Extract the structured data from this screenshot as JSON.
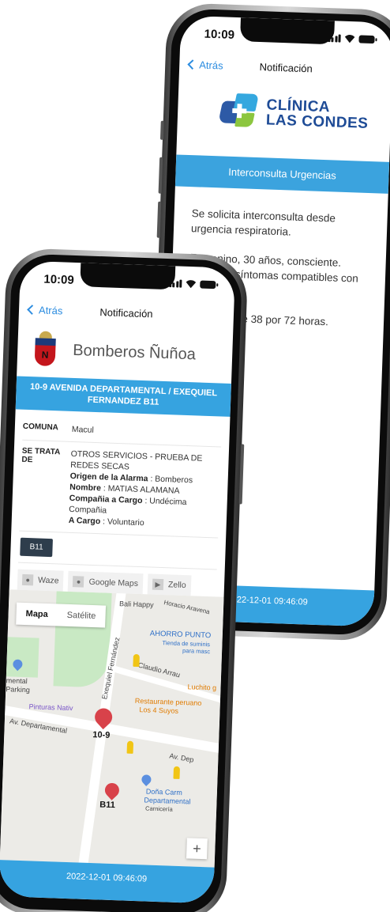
{
  "back_phone": {
    "status_time": "10:09",
    "back_label": "Atrás",
    "nav_title": "Notificación",
    "logo_line1": "CLÍNICA",
    "logo_line2": "LAS CONDES",
    "banner": "Interconsulta Urgencias",
    "body": [
      "Se solicita interconsulta desde urgencia respiratoria.",
      "Femenino, 30 años, consciente. Presenta síntomas compatibles con FQ.",
      "Fiebre sobre 38 por 72 horas."
    ],
    "footer": "2022-12-01 09:46:09"
  },
  "front_phone": {
    "status_time": "10:09",
    "back_label": "Atrás",
    "nav_title": "Notificación",
    "org_name": "Bomberos Ñuñoa",
    "banner": "10-9 AVENIDA DEPARTAMENTAL / EXEQUIEL FERNANDEZ B11",
    "comuna_label": "COMUNA",
    "comuna_value": "Macul",
    "se_trata_label": "SE TRATA DE",
    "se_trata_value": "OTROS SERVICIOS - PRUEBA DE REDES SECAS",
    "origen_label": "Origen de la Alarma",
    "origen_value": ": Bomberos",
    "nombre_label": "Nombre",
    "nombre_value": ": MATIAS ALAMANA",
    "compania_label": "Compañia a Cargo",
    "compania_value": ": Undécima Compañia",
    "acargo_label": "A Cargo",
    "acargo_value": ": Voluntario",
    "unit": "B11",
    "apps": [
      "Waze",
      "Google Maps",
      "Zello"
    ],
    "map": {
      "tab_map": "Mapa",
      "tab_sat": "Satélite",
      "labels": {
        "bali": "Bali Happy",
        "horacio": "Horacio Aravena",
        "ahorro": "AHORRO PUNTO",
        "ahorro_sub1": "Tienda de suminis",
        "ahorro_sub2": "para masc",
        "exequiel": "Exequiel Fernández",
        "claudio": "Claudio Arrau",
        "luchito": "Luchito g",
        "restaurante1": "Restaurante peruano",
        "restaurante2": "Los 4 Suyos",
        "mental": "mental",
        "parking": "Parking",
        "pinturas": "Pinturas Nativ",
        "av_dep": "Av. Departamental",
        "av_dep2": "Av. Dep",
        "dona1": "Doña Carm",
        "dona2": "Departamental",
        "dona3": "Carnicería",
        "m109": "10-9",
        "mb11": "B11"
      },
      "zoom": "+"
    },
    "footer": "2022-12-01 09:46:09"
  },
  "colors": {
    "accent": "#36a3e0",
    "link": "#2d8de0",
    "unit_tag": "#2e3d4c",
    "clinic_blue": "#1e4b96"
  }
}
